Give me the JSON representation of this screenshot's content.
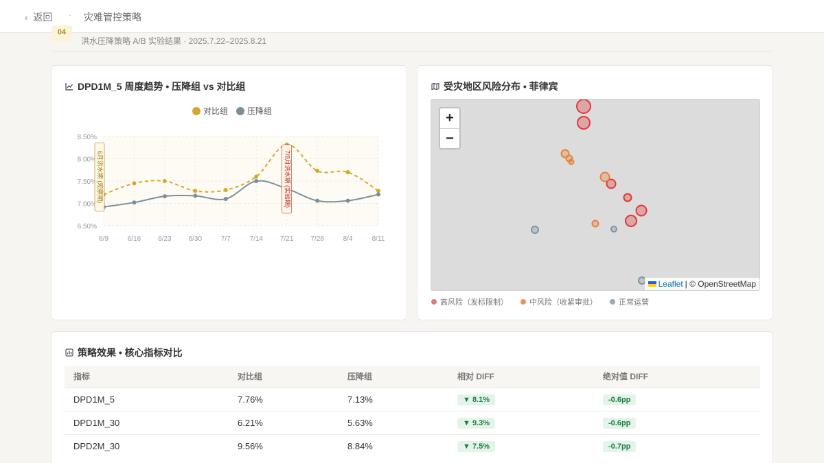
{
  "topbar": {
    "back_label": "返回",
    "breadcrumb": "灾难管控策略"
  },
  "section": {
    "number": "04",
    "subtitle": "洪水压降策略 A/B 实验结果 · 2025.7.22–2025.8.21"
  },
  "trend_card": {
    "title": "DPD1M_5 周度趋势 • 压降组 vs 对比组",
    "icon": "line-chart-icon",
    "legend": [
      {
        "name": "对比组",
        "color": "#d4a82c"
      },
      {
        "name": "压降组",
        "color": "#7a8f9e"
      }
    ]
  },
  "chart_data": {
    "type": "line",
    "x": [
      "6/9",
      "6/16",
      "6/23",
      "6/30",
      "7/7",
      "7/14",
      "7/21",
      "7/28",
      "8/4",
      "8/11"
    ],
    "series": [
      {
        "name": "对比组",
        "values": [
          7.2,
          7.45,
          7.5,
          7.28,
          7.3,
          7.6,
          8.32,
          7.73,
          7.7,
          7.28
        ],
        "color": "#d4a82c",
        "style": "dashed"
      },
      {
        "name": "压降组",
        "values": [
          6.92,
          7.02,
          7.16,
          7.17,
          7.1,
          7.5,
          7.33,
          7.06,
          7.06,
          7.2
        ],
        "color": "#7a8f9e",
        "style": "solid"
      }
    ],
    "ylim": [
      6.5,
      8.5
    ],
    "yticks": [
      "6.50%",
      "7.00%",
      "7.50%",
      "8.00%",
      "8.50%"
    ],
    "grid": true,
    "legend_position": "top-center",
    "annotations": [
      {
        "at": "6/9",
        "text": "6月洪水期 (观察期)",
        "color": "#a07b12"
      },
      {
        "at": "7/21",
        "text": "7/8月洪水期 (实验期)",
        "color": "#b52a2a"
      }
    ],
    "shaded_ranges": [
      [
        "6/9",
        "7/14"
      ],
      [
        "7/14",
        "8/11"
      ]
    ]
  },
  "map_card": {
    "title": "受灾地区风险分布 • 菲律宾",
    "icon": "map-icon",
    "zoom_in": "+",
    "zoom_out": "−",
    "attribution_link": "Leaflet",
    "attribution_text": "| © OpenStreetMap",
    "legend": [
      {
        "label": "高风险（发标限制）",
        "color": "#e07a7a"
      },
      {
        "label": "中风险（收紧审批）",
        "color": "#e8955a"
      },
      {
        "label": "正常运营",
        "color": "#9aaab5"
      }
    ],
    "colors": {
      "high": "#e03a3a",
      "medium": "#e8813a",
      "normal": "#7f95a4"
    }
  },
  "table_card": {
    "title": "策略效果 • 核心指标对比",
    "icon": "stats-icon",
    "columns": [
      "指标",
      "对比组",
      "压降组",
      "相对 DIFF",
      "绝对值 DIFF"
    ],
    "rows": [
      {
        "metric": "DPD1M_5",
        "control": "7.76%",
        "treatment": "7.13%",
        "rel": "▼ 8.1%",
        "abs": "-0.6pp"
      },
      {
        "metric": "DPD1M_30",
        "control": "6.21%",
        "treatment": "5.63%",
        "rel": "▼ 9.3%",
        "abs": "-0.6pp"
      },
      {
        "metric": "DPD2M_30",
        "control": "9.56%",
        "treatment": "8.84%",
        "rel": "▼ 7.5%",
        "abs": "-0.7pp"
      }
    ]
  }
}
